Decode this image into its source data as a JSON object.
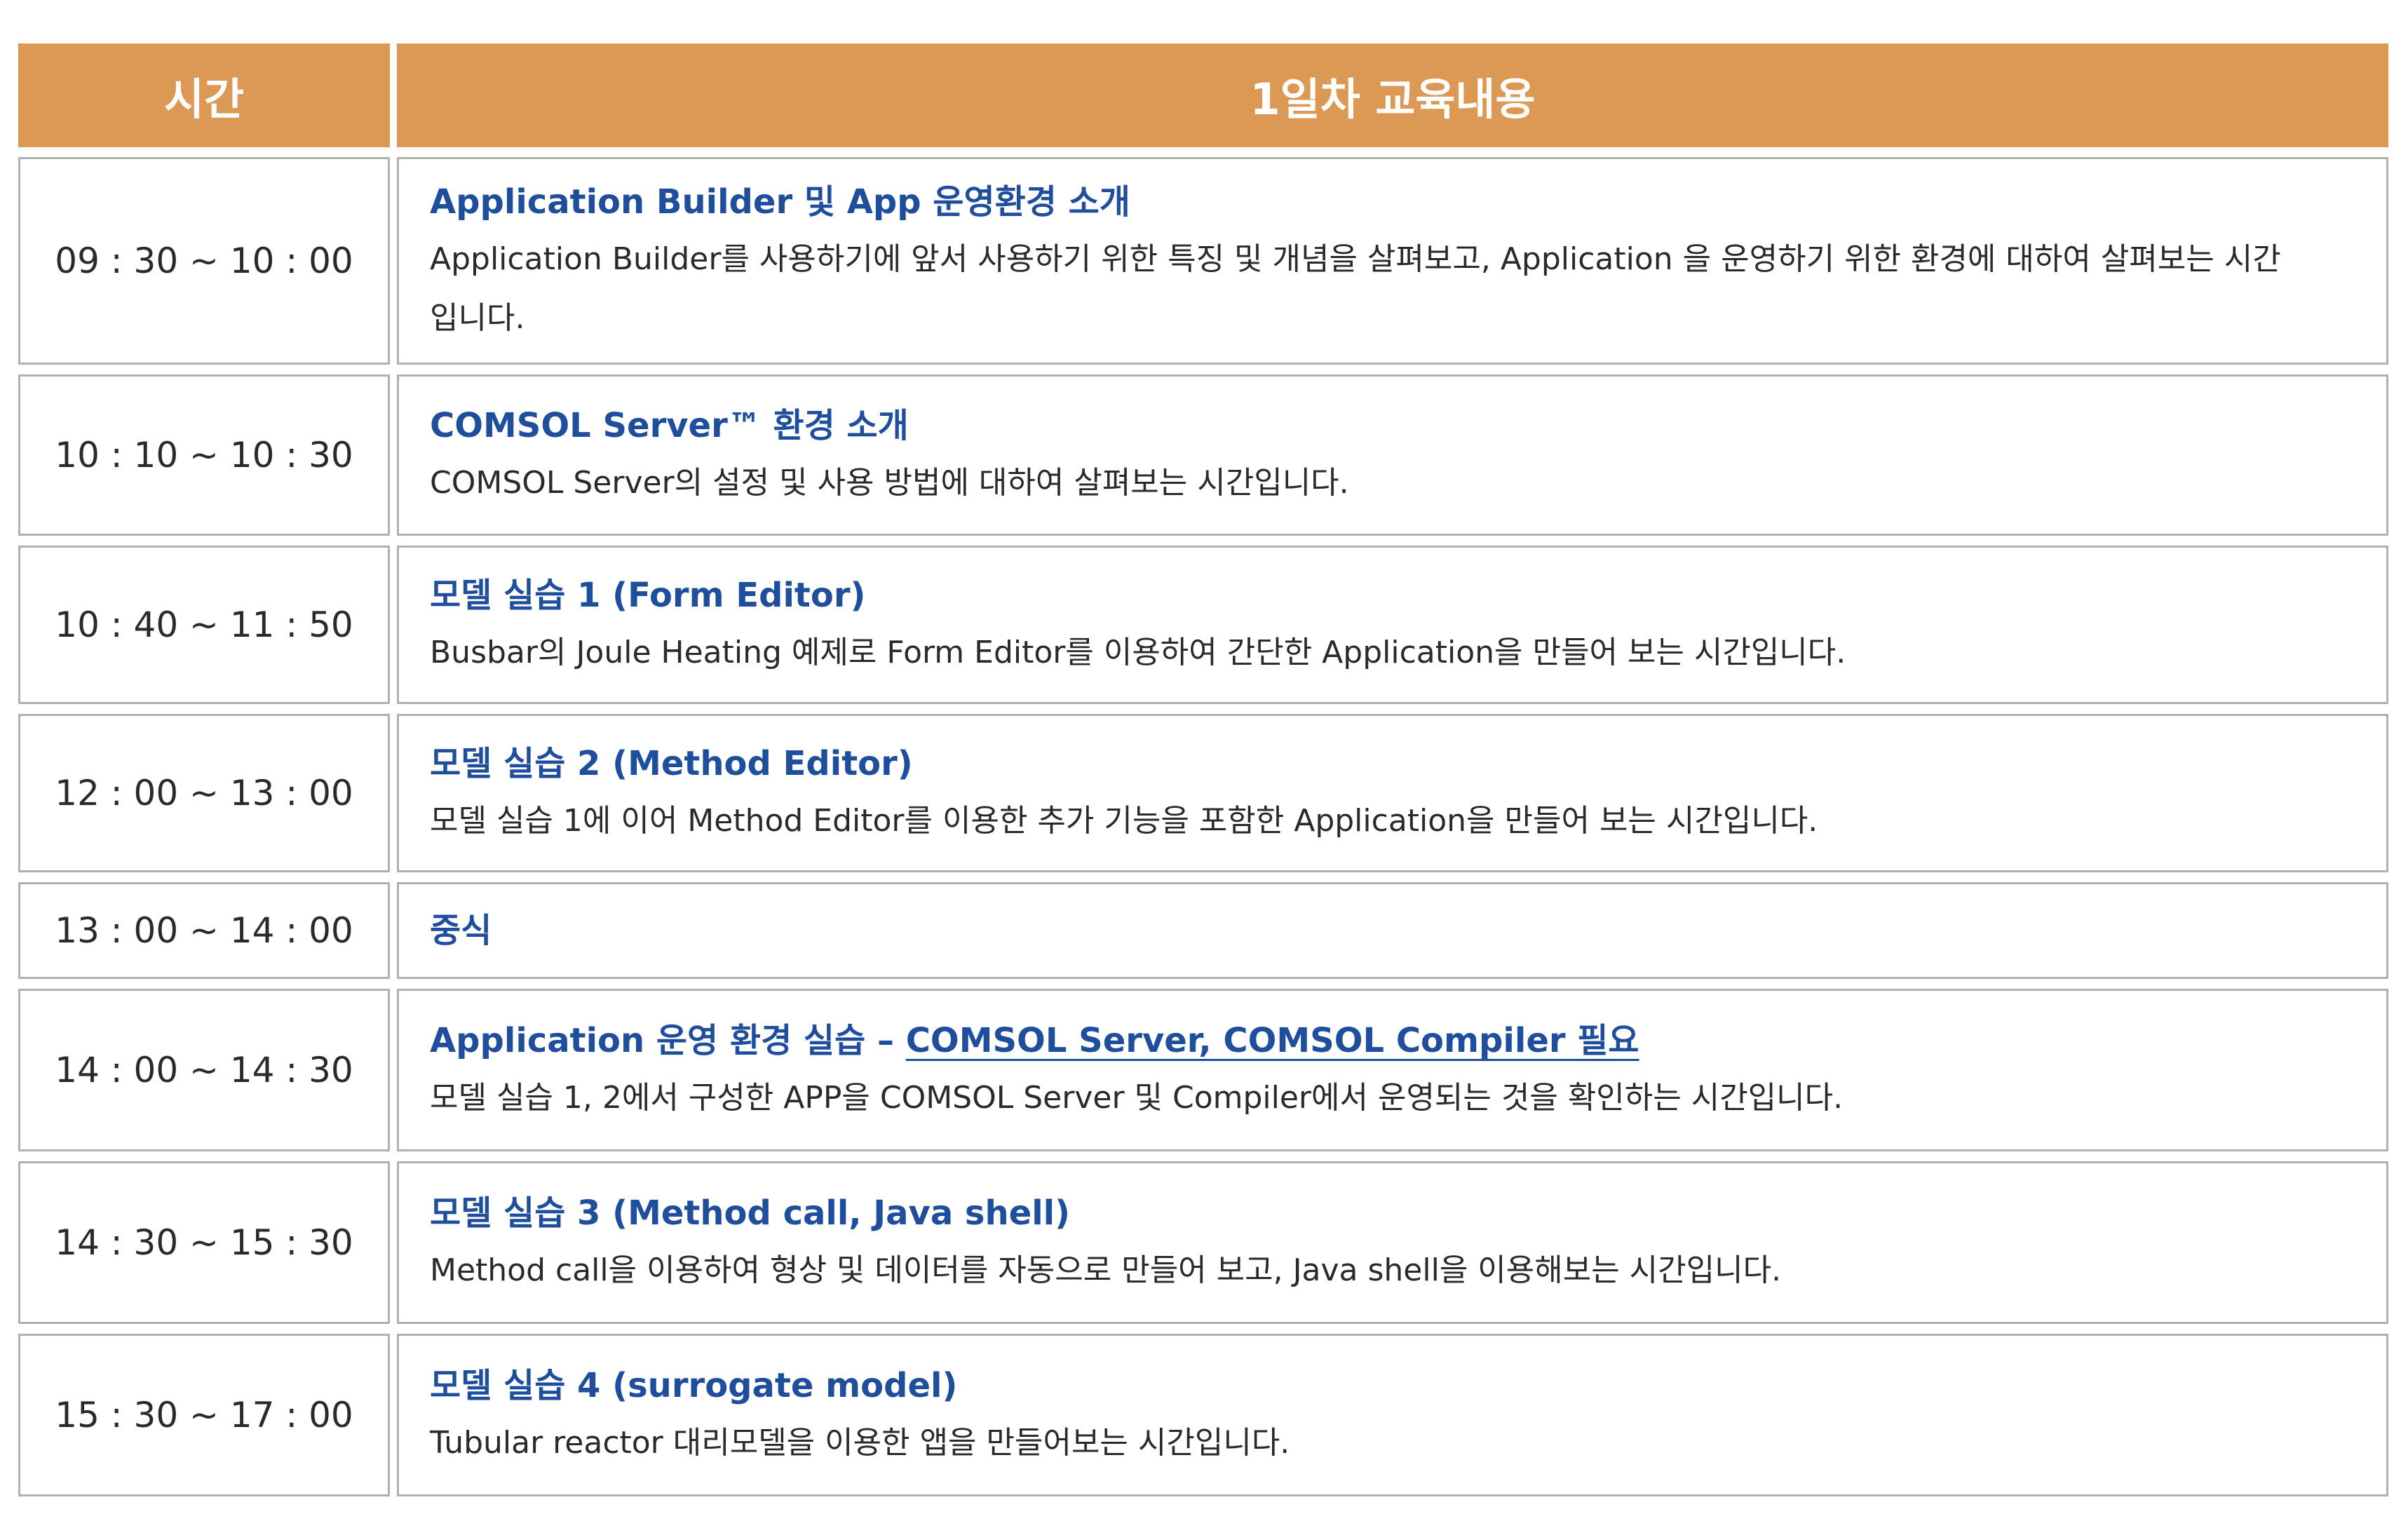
{
  "header": {
    "time": "시간",
    "content": "1일차 교육내용"
  },
  "sessions": [
    {
      "time": "09 : 30 ~ 10 : 00",
      "title": "Application Builder 및 App 운영환경 소개",
      "description": "Application Builder를 사용하기에 앞서 사용하기 위한 특징 및 개념을 살펴보고, Application 을 운영하기 위한 환경에 대하여 살펴보는 시간입니다."
    },
    {
      "time": "10 : 10 ~ 10 : 30",
      "title": "COMSOL Server™ 환경 소개",
      "description": "COMSOL Server의 설정 및 사용 방법에 대하여 살펴보는 시간입니다."
    },
    {
      "time": "10 : 40 ~ 11 : 50",
      "title": "모델 실습 1 (Form Editor)",
      "description": "Busbar의 Joule Heating 예제로 Form Editor를 이용하여 간단한 Application을 만들어 보는 시간입니다."
    },
    {
      "time": "12 : 00 ~ 13 : 00",
      "title": "모델 실습 2 (Method Editor)",
      "description": "모델 실습 1에 이어 Method Editor를 이용한 추가 기능을 포함한 Application을 만들어 보는 시간입니다."
    },
    {
      "time": "13 : 00 ~ 14 : 00",
      "title": "중식",
      "description": ""
    },
    {
      "time": "14 : 00 ~ 14 : 30",
      "title_prefix": "Application 운영 환경 실습 – ",
      "title_link": "COMSOL Server, COMSOL Compiler 필요",
      "description": "모델 실습 1, 2에서 구성한 APP을 COMSOL Server 및 Compiler에서 운영되는 것을 확인하는 시간입니다."
    },
    {
      "time": "14 : 30 ~ 15 : 30",
      "title": "모델 실습 3 (Method call, Java shell)",
      "description": "Method call을 이용하여 형상 및 데이터를 자동으로 만들어 보고, Java shell을 이용해보는 시간입니다."
    },
    {
      "time": "15 : 30 ~ 17 : 00",
      "title": "모델 실습 4 (surrogate model)",
      "description": "Tubular reactor 대리모델을 이용한 앱을 만들어보는 시간입니다."
    }
  ],
  "colors": {
    "header_bg": "#dc9955",
    "title_text": "#1f4e9c",
    "border": "#b0b0b0"
  }
}
